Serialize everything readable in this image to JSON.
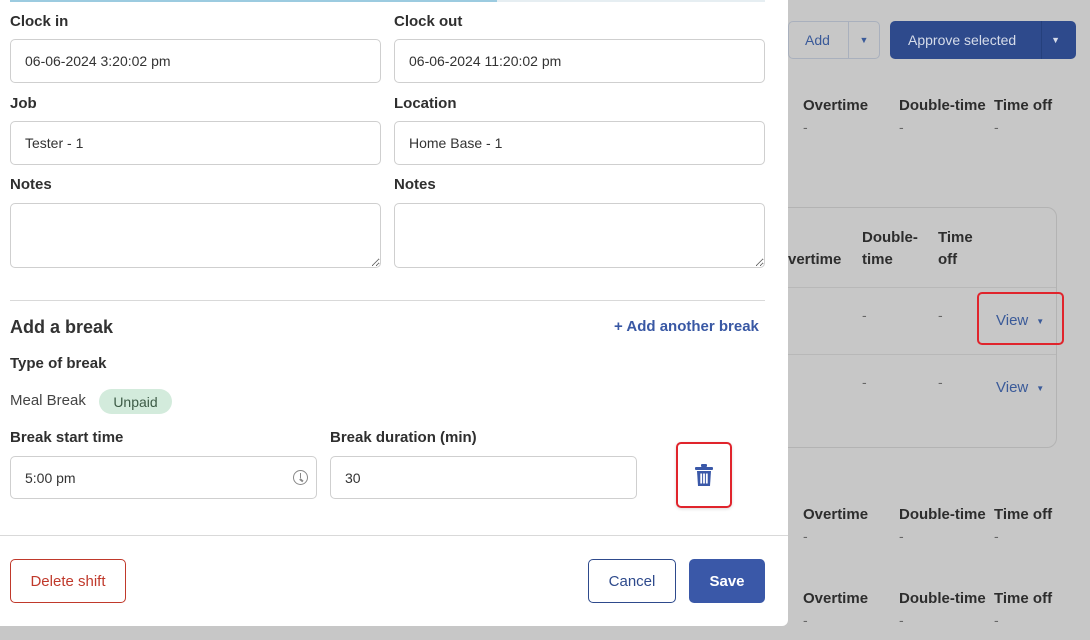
{
  "background": {
    "add_label": "Add",
    "approve_label": "Approve selected",
    "headers": {
      "overtime": "Overtime",
      "double_time": "Double-time",
      "time_off": "Time off",
      "overtime_trunc": "vertime",
      "double_line1": "Double-",
      "double_line2": "time",
      "timeoff_line1": "Time",
      "timeoff_line2": "off"
    },
    "dash": "-",
    "view_label": "View"
  },
  "form": {
    "clock_in": {
      "label": "Clock in",
      "value": "06-06-2024 3:20:02 pm"
    },
    "clock_out": {
      "label": "Clock out",
      "value": "06-06-2024 11:20:02 pm"
    },
    "job": {
      "label": "Job",
      "value": "Tester - 1"
    },
    "location": {
      "label": "Location",
      "value": "Home Base - 1"
    },
    "notes_left": {
      "label": "Notes",
      "value": ""
    },
    "notes_right": {
      "label": "Notes",
      "value": ""
    }
  },
  "break_section": {
    "title": "Add a break",
    "add_another": "+ Add another break",
    "type_label": "Type of break",
    "type_value": "Meal Break",
    "paid_badge": "Unpaid",
    "start_label": "Break start time",
    "start_value": "5:00 pm",
    "duration_label": "Break duration (min)",
    "duration_value": "30"
  },
  "footer": {
    "delete_label": "Delete shift",
    "cancel_label": "Cancel",
    "save_label": "Save"
  },
  "colors": {
    "primary": "#3a58a8",
    "danger": "#c0392b",
    "highlight": "#e0242c",
    "badge_bg": "#d3ebdc"
  }
}
